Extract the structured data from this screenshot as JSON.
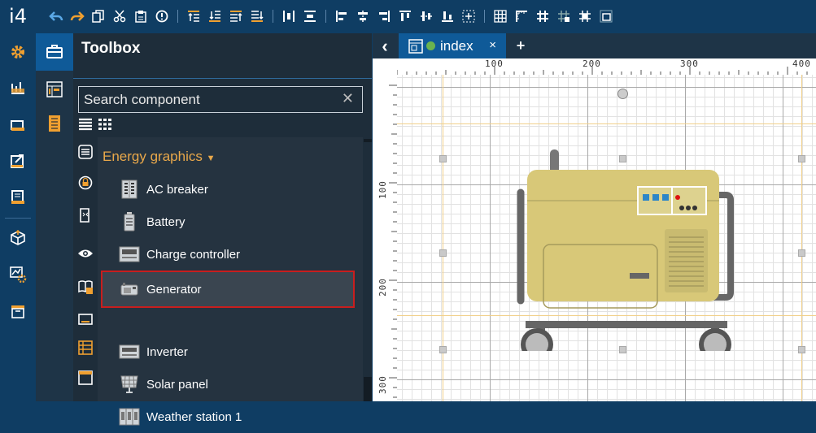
{
  "app": {
    "brand": "i4"
  },
  "toolbar": {
    "icons": [
      "undo-icon",
      "redo-icon",
      "copy-icon",
      "cut-icon",
      "paste-icon",
      "delete-icon",
      "bring-forward-icon",
      "send-backward-icon",
      "bring-to-front-icon",
      "send-to-back-icon",
      "distribute-horizontal-icon",
      "distribute-vertical-icon",
      "align-left-icon",
      "align-center-icon",
      "align-right-icon",
      "align-top-icon",
      "align-middle-icon",
      "align-bottom-icon",
      "center-icon",
      "grid-icon",
      "ruler-icon",
      "snap-grid-icon",
      "grid-settings-icon",
      "snap-icon",
      "fit-screen-icon"
    ]
  },
  "toolbox": {
    "title": "Toolbox",
    "search_placeholder": "Search component",
    "group": "Energy graphics",
    "items": [
      {
        "label": "AC breaker",
        "icon": "ac-breaker-icon"
      },
      {
        "label": "Battery",
        "icon": "battery-icon"
      },
      {
        "label": "Charge controller",
        "icon": "charge-controller-icon"
      },
      {
        "label": "Generator",
        "icon": "generator-icon",
        "selected": true
      },
      {
        "label": "Inverter",
        "icon": "inverter-icon"
      },
      {
        "label": "Solar panel",
        "icon": "solar-panel-icon"
      },
      {
        "label": "Weather station 1",
        "icon": "weather-station-icon"
      }
    ]
  },
  "editor": {
    "tab_name": "index",
    "close": "×",
    "add": "+",
    "back": "‹",
    "ruler_top": [
      "100",
      "200",
      "300",
      "400"
    ],
    "ruler_left": [
      "100",
      "200",
      "300"
    ]
  },
  "colors": {
    "accent": "#0f5a98",
    "bg_dark": "#0f3d63",
    "panel": "#1e2d3a",
    "highlight": "#e9a84a",
    "selection": "#c81e1e",
    "generator_body": "#d8c878"
  }
}
